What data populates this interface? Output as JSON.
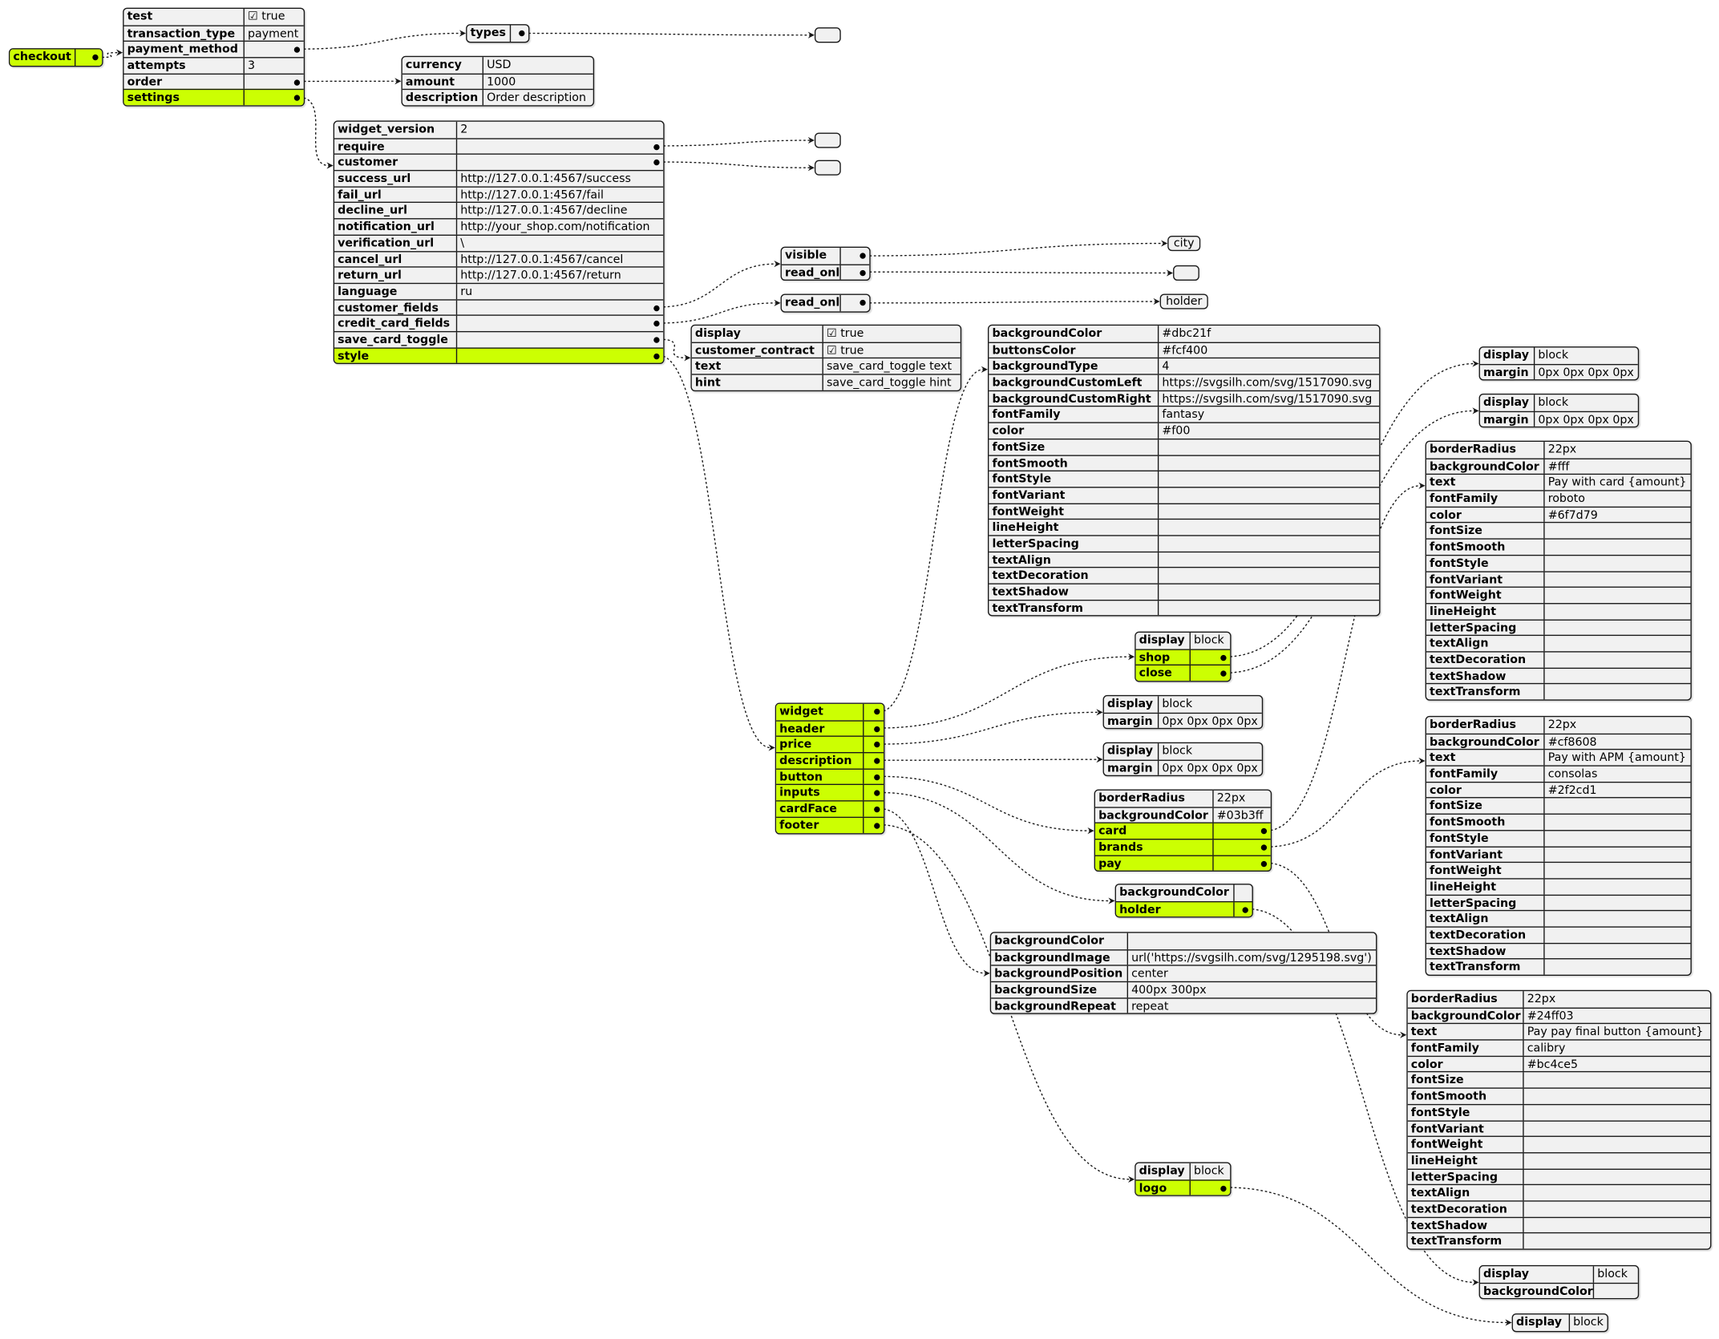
{
  "colors": {
    "highlight": "#ccff02",
    "box_fill": "#f1f1f1",
    "line": "#181818"
  },
  "tables": {
    "checkout": {
      "rows": [
        {
          "k": "checkout",
          "ref": "root",
          "hl": true
        }
      ]
    },
    "root": {
      "rows": [
        {
          "k": "test",
          "v": "☑ true"
        },
        {
          "k": "transaction_type",
          "v": "payment"
        },
        {
          "k": "payment_method",
          "ref": "payment_method"
        },
        {
          "k": "attempts",
          "v": "3"
        },
        {
          "k": "order",
          "ref": "order"
        },
        {
          "k": "settings",
          "ref": "settings",
          "hl": true
        }
      ]
    },
    "payment_method": {
      "rows": [
        {
          "k": "types",
          "ref": "types_arr"
        }
      ]
    },
    "order": {
      "rows": [
        {
          "k": "currency",
          "v": "USD"
        },
        {
          "k": "amount",
          "v": "1000"
        },
        {
          "k": "description",
          "v": "Order description"
        }
      ]
    },
    "settings": {
      "rows": [
        {
          "k": "widget_version",
          "v": "2"
        },
        {
          "k": "require",
          "ref": "require_arr"
        },
        {
          "k": "customer",
          "ref": "customer_arr"
        },
        {
          "k": "success_url",
          "v": "http://127.0.0.1:4567/success"
        },
        {
          "k": "fail_url",
          "v": "http://127.0.0.1:4567/fail"
        },
        {
          "k": "decline_url",
          "v": "http://127.0.0.1:4567/decline"
        },
        {
          "k": "notification_url",
          "v": "http://your_shop.com/notification"
        },
        {
          "k": "verification_url",
          "v": "\\"
        },
        {
          "k": "cancel_url",
          "v": "http://127.0.0.1:4567/cancel"
        },
        {
          "k": "return_url",
          "v": "http://127.0.0.1:4567/return"
        },
        {
          "k": "language",
          "v": "ru"
        },
        {
          "k": "customer_fields",
          "ref": "customer_fields"
        },
        {
          "k": "credit_card_fields",
          "ref": "credit_card_fields"
        },
        {
          "k": "save_card_toggle",
          "ref": "save_card_toggle"
        },
        {
          "k": "style",
          "ref": "style",
          "hl": true
        }
      ]
    },
    "customer_fields": {
      "rows": [
        {
          "k": "visible",
          "ref": "visible_arr"
        },
        {
          "k": "read_only",
          "ref": "cf_read_only_arr"
        }
      ]
    },
    "credit_card_fields": {
      "rows": [
        {
          "k": "read_only",
          "ref": "ccf_read_only_arr"
        }
      ]
    },
    "save_card_toggle": {
      "rows": [
        {
          "k": "display",
          "v": "☑ true"
        },
        {
          "k": "customer_contract",
          "v": "☑ true"
        },
        {
          "k": "text",
          "v": "save_card_toggle text"
        },
        {
          "k": "hint",
          "v": "save_card_toggle hint"
        }
      ]
    },
    "style": {
      "rows": [
        {
          "k": "widget",
          "ref": "widget",
          "hl": true
        },
        {
          "k": "header",
          "ref": "header",
          "hl": true
        },
        {
          "k": "price",
          "ref": "price",
          "hl": true
        },
        {
          "k": "description",
          "ref": "description",
          "hl": true
        },
        {
          "k": "button",
          "ref": "button",
          "hl": true
        },
        {
          "k": "inputs",
          "ref": "inputs",
          "hl": true
        },
        {
          "k": "cardFace",
          "ref": "cardFace",
          "hl": true
        },
        {
          "k": "footer",
          "ref": "footer",
          "hl": true
        }
      ]
    },
    "widget": {
      "rows": [
        {
          "k": "backgroundColor",
          "v": "#dbc21f"
        },
        {
          "k": "buttonsColor",
          "v": "#fcf400"
        },
        {
          "k": "backgroundType",
          "v": "4"
        },
        {
          "k": "backgroundCustomLeft",
          "v": "https://svgsilh.com/svg/1517090.svg"
        },
        {
          "k": "backgroundCustomRight",
          "v": "https://svgsilh.com/svg/1517090.svg"
        },
        {
          "k": "fontFamily",
          "v": "fantasy"
        },
        {
          "k": "color",
          "v": "#f00"
        },
        {
          "k": "fontSize",
          "v": ""
        },
        {
          "k": "fontSmooth",
          "v": ""
        },
        {
          "k": "fontStyle",
          "v": ""
        },
        {
          "k": "fontVariant",
          "v": ""
        },
        {
          "k": "fontWeight",
          "v": ""
        },
        {
          "k": "lineHeight",
          "v": ""
        },
        {
          "k": "letterSpacing",
          "v": ""
        },
        {
          "k": "textAlign",
          "v": ""
        },
        {
          "k": "textDecoration",
          "v": ""
        },
        {
          "k": "textShadow",
          "v": ""
        },
        {
          "k": "textTransform",
          "v": ""
        }
      ]
    },
    "header": {
      "rows": [
        {
          "k": "display",
          "v": "block"
        },
        {
          "k": "shop",
          "ref": "shop",
          "hl": true
        },
        {
          "k": "close",
          "ref": "close",
          "hl": true
        }
      ]
    },
    "shop": {
      "rows": [
        {
          "k": "display",
          "v": "block"
        },
        {
          "k": "margin",
          "v": "0px 0px 0px 0px"
        }
      ]
    },
    "close": {
      "rows": [
        {
          "k": "display",
          "v": "block"
        },
        {
          "k": "margin",
          "v": "0px 0px 0px 0px"
        }
      ]
    },
    "price": {
      "rows": [
        {
          "k": "display",
          "v": "block"
        },
        {
          "k": "margin",
          "v": "0px 0px 0px 0px"
        }
      ]
    },
    "description": {
      "rows": [
        {
          "k": "display",
          "v": "block"
        },
        {
          "k": "margin",
          "v": "0px 0px 0px 0px"
        }
      ]
    },
    "button": {
      "rows": [
        {
          "k": "borderRadius",
          "v": "22px"
        },
        {
          "k": "backgroundColor",
          "v": "#03b3ff"
        },
        {
          "k": "card",
          "ref": "card",
          "hl": true
        },
        {
          "k": "brands",
          "ref": "brands",
          "hl": true
        },
        {
          "k": "pay",
          "ref": "pay",
          "hl": true
        }
      ]
    },
    "card": {
      "rows": [
        {
          "k": "borderRadius",
          "v": "22px"
        },
        {
          "k": "backgroundColor",
          "v": "#fff"
        },
        {
          "k": "text",
          "v": "Pay with card {amount}"
        },
        {
          "k": "fontFamily",
          "v": "roboto"
        },
        {
          "k": "color",
          "v": "#6f7d79"
        },
        {
          "k": "fontSize",
          "v": ""
        },
        {
          "k": "fontSmooth",
          "v": ""
        },
        {
          "k": "fontStyle",
          "v": ""
        },
        {
          "k": "fontVariant",
          "v": ""
        },
        {
          "k": "fontWeight",
          "v": ""
        },
        {
          "k": "lineHeight",
          "v": ""
        },
        {
          "k": "letterSpacing",
          "v": ""
        },
        {
          "k": "textAlign",
          "v": ""
        },
        {
          "k": "textDecoration",
          "v": ""
        },
        {
          "k": "textShadow",
          "v": ""
        },
        {
          "k": "textTransform",
          "v": ""
        }
      ]
    },
    "brands": {
      "rows": [
        {
          "k": "borderRadius",
          "v": "22px"
        },
        {
          "k": "backgroundColor",
          "v": "#cf8608"
        },
        {
          "k": "text",
          "v": "Pay with APM {amount}"
        },
        {
          "k": "fontFamily",
          "v": "consolas"
        },
        {
          "k": "color",
          "v": "#2f2cd1"
        },
        {
          "k": "fontSize",
          "v": ""
        },
        {
          "k": "fontSmooth",
          "v": ""
        },
        {
          "k": "fontStyle",
          "v": ""
        },
        {
          "k": "fontVariant",
          "v": ""
        },
        {
          "k": "fontWeight",
          "v": ""
        },
        {
          "k": "lineHeight",
          "v": ""
        },
        {
          "k": "letterSpacing",
          "v": ""
        },
        {
          "k": "textAlign",
          "v": ""
        },
        {
          "k": "textDecoration",
          "v": ""
        },
        {
          "k": "textShadow",
          "v": ""
        },
        {
          "k": "textTransform",
          "v": ""
        }
      ]
    },
    "pay": {
      "rows": [
        {
          "k": "borderRadius",
          "v": "22px"
        },
        {
          "k": "backgroundColor",
          "v": "#24ff03"
        },
        {
          "k": "text",
          "v": "Pay pay final button {amount}"
        },
        {
          "k": "fontFamily",
          "v": "calibry"
        },
        {
          "k": "color",
          "v": "#bc4ce5"
        },
        {
          "k": "fontSize",
          "v": ""
        },
        {
          "k": "fontSmooth",
          "v": ""
        },
        {
          "k": "fontStyle",
          "v": ""
        },
        {
          "k": "fontVariant",
          "v": ""
        },
        {
          "k": "fontWeight",
          "v": ""
        },
        {
          "k": "lineHeight",
          "v": ""
        },
        {
          "k": "letterSpacing",
          "v": ""
        },
        {
          "k": "textAlign",
          "v": ""
        },
        {
          "k": "textDecoration",
          "v": ""
        },
        {
          "k": "textShadow",
          "v": ""
        },
        {
          "k": "textTransform",
          "v": ""
        }
      ]
    },
    "inputs": {
      "rows": [
        {
          "k": "backgroundColor",
          "v": ""
        },
        {
          "k": "holder",
          "ref": "holder",
          "hl": true
        }
      ]
    },
    "holder": {
      "rows": [
        {
          "k": "display",
          "v": "block"
        },
        {
          "k": "backgroundColor",
          "v": ""
        }
      ]
    },
    "cardFace": {
      "rows": [
        {
          "k": "backgroundColor",
          "v": ""
        },
        {
          "k": "backgroundImage",
          "v": "url('https://svgsilh.com/svg/1295198.svg')"
        },
        {
          "k": "backgroundPosition",
          "v": "center"
        },
        {
          "k": "backgroundSize",
          "v": "400px 300px"
        },
        {
          "k": "backgroundRepeat",
          "v": "repeat"
        }
      ]
    },
    "footer": {
      "rows": [
        {
          "k": "display",
          "v": "block"
        },
        {
          "k": "logo",
          "ref": "logo",
          "hl": true
        }
      ]
    },
    "logo": {
      "rows": [
        {
          "k": "display",
          "v": "block"
        }
      ]
    }
  },
  "leaves": {
    "types_arr": {
      "text": ""
    },
    "require_arr": {
      "text": ""
    },
    "customer_arr": {
      "text": ""
    },
    "visible_arr": {
      "text": "city"
    },
    "cf_read_only_arr": {
      "text": ""
    },
    "ccf_read_only_arr": {
      "text": "holder"
    }
  }
}
